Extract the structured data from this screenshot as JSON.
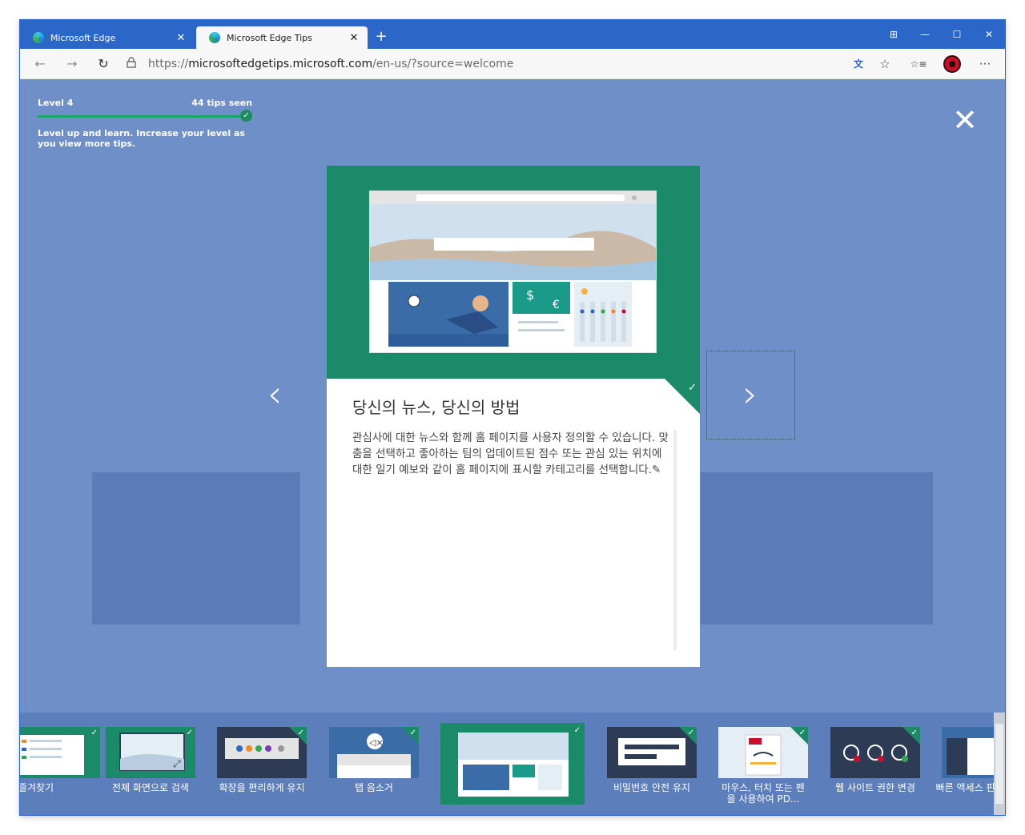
{
  "tabs": [
    {
      "title": "Microsoft Edge",
      "active": false
    },
    {
      "title": "Microsoft Edge Tips",
      "active": true
    }
  ],
  "tab_close_glyph": "✕",
  "new_tab_glyph": "+",
  "window_controls": [
    "⊞",
    "—",
    "☐",
    "✕"
  ],
  "address": {
    "prefix": "https://",
    "domain": "microsoftedgetips.microsoft.com",
    "path": "/en-us/?source=welcome"
  },
  "level": {
    "label": "Level 4",
    "tips_seen": "44 tips seen",
    "description": "Level up and learn. Increase your level as you view more tips.",
    "progress": 1.0
  },
  "card": {
    "title": "당신의 뉴스, 당신의 방법",
    "body": "관심사에 대한 뉴스와 함께 홈 페이지를 사용자 정의할 수 있습니다. 맞춤을 선택하고 좋아하는 팀의 업데이트된 점수 또는 관심 있는 위치에 대한 일기 예보와 같이 홈 페이지에 표시할 카테고리를 선택합니다.",
    "edit_glyph": "✎"
  },
  "thumbnails": [
    {
      "label": "즐겨찾기",
      "seen": true
    },
    {
      "label": "전체 화면으로 검색",
      "seen": true
    },
    {
      "label": "확장을 편리하게 유지",
      "seen": true
    },
    {
      "label": "탭 음소거",
      "seen": true
    },
    {
      "label": "",
      "seen": true,
      "active": true
    },
    {
      "label": "비밀번호 안전 유지",
      "seen": true
    },
    {
      "label": "마우스, 터치 또는 펜을 사용하여 PD...",
      "seen": true
    },
    {
      "label": "웹 사이트 권한 변경",
      "seen": true
    },
    {
      "label": "빠른 액세스 핀 탭",
      "seen": false
    }
  ],
  "icons": {
    "back": "←",
    "forward": "→",
    "refresh": "↻",
    "lock": "🔒",
    "translate": "文",
    "favorite": "☆",
    "favorites_list": "☆≡",
    "more": "···",
    "close_overlay": "✕",
    "prev": "‹",
    "next": "›",
    "check": "✓"
  },
  "colors": {
    "accent": "#1b8a68",
    "titlebar": "#2b66c9",
    "overlay": "#6f8fc8"
  }
}
